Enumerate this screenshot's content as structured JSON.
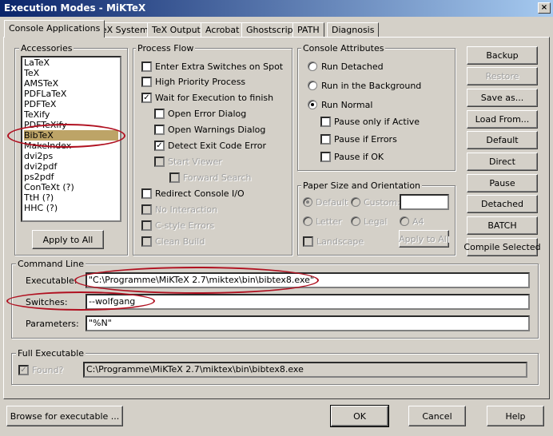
{
  "window": {
    "title": "Execution Modes - MiKTeX",
    "close_label": "×"
  },
  "tabs": [
    {
      "label": "Console Applications"
    },
    {
      "label": "TeX System"
    },
    {
      "label": "TeX Output"
    },
    {
      "label": "Acrobat"
    },
    {
      "label": "Ghostscript"
    },
    {
      "label": "PATH"
    },
    {
      "label": "Diagnosis"
    }
  ],
  "accessories": {
    "title": "Accessories",
    "items": [
      "LaTeX",
      "TeX",
      "AMSTeX",
      "PDFLaTeX",
      "PDFTeX",
      "TeXify",
      "PDFTeXify",
      "BibTeX",
      "MakeIndex",
      "dvi2ps",
      "dvi2pdf",
      "ps2pdf",
      "ConTeXt  (?)",
      "TtH  (?)",
      "HHC  (?)"
    ],
    "selected": "BibTeX",
    "apply_all_label": "Apply to All"
  },
  "process_flow": {
    "title": "Process Flow",
    "extra_switches": "Enter Extra Switches on Spot",
    "high_priority": "High Priority Process",
    "wait_exec": "Wait for Execution to finish",
    "open_error": "Open Error Dialog",
    "open_warnings": "Open Warnings Dialog",
    "detect_exit": "Detect Exit Code Error",
    "start_viewer": "Start Viewer",
    "forward_search": "Forward Search",
    "redirect_console": "Redirect Console I/O",
    "no_interaction": "No Interaction",
    "cstyle_errors": "C-style Errors",
    "clean_build": "Clean Build"
  },
  "console_attributes": {
    "title": "Console Attributes",
    "run_detached": "Run Detached",
    "run_background": "Run in the Background",
    "run_normal": "Run Normal",
    "pause_active": "Pause only if Active",
    "pause_errors": "Pause if Errors",
    "pause_ok": "Pause if OK"
  },
  "paper": {
    "title": "Paper Size and Orientation",
    "default": "Default",
    "custom": "Custom:",
    "letter": "Letter",
    "legal": "Legal",
    "a4": "A4",
    "landscape": "Landscape",
    "apply_all": "Apply to All",
    "custom_value": ""
  },
  "side_buttons": {
    "backup": "Backup",
    "restore": "Restore",
    "save_as": "Save as...",
    "load_from": "Load From...",
    "default": "Default",
    "direct": "Direct",
    "pause": "Pause",
    "detached": "Detached",
    "batch": "BATCH",
    "compile_selected": "Compile Selected"
  },
  "command_line": {
    "title": "Command Line",
    "executable_label": "Executable:",
    "executable_value": "\"C:\\Programme\\MiKTeX 2.7\\miktex\\bin\\bibtex8.exe\"",
    "switches_label": "Switches:",
    "switches_value": "--wolfgang",
    "parameters_label": "Parameters:",
    "parameters_value": "\"%N\""
  },
  "full_executable": {
    "title": "Full Executable",
    "found_label": "Found?",
    "path": "C:\\Programme\\MiKTeX 2.7\\miktex\\bin\\bibtex8.exe"
  },
  "footer": {
    "browse": "Browse for executable ...",
    "ok": "OK",
    "cancel": "Cancel",
    "help": "Help"
  }
}
